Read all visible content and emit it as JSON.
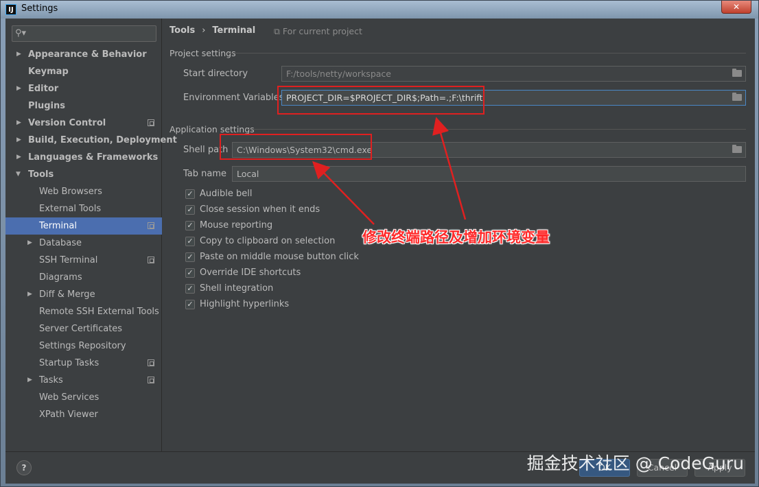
{
  "window": {
    "title": "Settings",
    "icon_text": "IJ",
    "close_label": "✕"
  },
  "search": {
    "placeholder": ""
  },
  "sidebar": {
    "items": [
      {
        "label": "Appearance & Behavior"
      },
      {
        "label": "Keymap"
      },
      {
        "label": "Editor"
      },
      {
        "label": "Plugins"
      },
      {
        "label": "Version Control"
      },
      {
        "label": "Build, Execution, Deployment"
      },
      {
        "label": "Languages & Frameworks"
      },
      {
        "label": "Tools"
      },
      {
        "label": "Web Browsers"
      },
      {
        "label": "External Tools"
      },
      {
        "label": "Terminal"
      },
      {
        "label": "Database"
      },
      {
        "label": "SSH Terminal"
      },
      {
        "label": "Diagrams"
      },
      {
        "label": "Diff & Merge"
      },
      {
        "label": "Remote SSH External Tools"
      },
      {
        "label": "Server Certificates"
      },
      {
        "label": "Settings Repository"
      },
      {
        "label": "Startup Tasks"
      },
      {
        "label": "Tasks"
      },
      {
        "label": "Web Services"
      },
      {
        "label": "XPath Viewer"
      }
    ]
  },
  "breadcrumb": {
    "parent": "Tools",
    "separator": "›",
    "current": "Terminal"
  },
  "scope_label": "For current project",
  "project_settings": {
    "title": "Project settings",
    "start_directory_label": "Start directory",
    "start_directory_value": "F:/tools/netty/workspace",
    "env_vars_label": "Environment Variables",
    "env_vars_value": "PROJECT_DIR=$PROJECT_DIR$;Path=.;F:\\thrift"
  },
  "application_settings": {
    "title": "Application settings",
    "shell_path_label": "Shell path",
    "shell_path_value": "C:\\Windows\\System32\\cmd.exe",
    "tab_name_label": "Tab name",
    "tab_name_value": "Local",
    "checkboxes": [
      {
        "label": "Audible bell",
        "checked": true
      },
      {
        "label": "Close session when it ends",
        "checked": true
      },
      {
        "label": "Mouse reporting",
        "checked": true
      },
      {
        "label": "Copy to clipboard on selection",
        "checked": true
      },
      {
        "label": "Paste on middle mouse button click",
        "checked": true
      },
      {
        "label": "Override IDE shortcuts",
        "checked": true
      },
      {
        "label": "Shell integration",
        "checked": true
      },
      {
        "label": "Highlight hyperlinks",
        "checked": true
      }
    ]
  },
  "bottom": {
    "help_label": "?",
    "ok_label": "OK",
    "cancel_label": "Cancel",
    "apply_label": "Apply"
  },
  "annotation": {
    "text": "修改终端路径及增加环境变量",
    "color": "#e02020"
  },
  "watermark": "掘金技术社区 @ CodeGuru",
  "colors": {
    "background": "#3c3f41",
    "selection": "#4b6eaf",
    "annotation": "#e02020"
  }
}
